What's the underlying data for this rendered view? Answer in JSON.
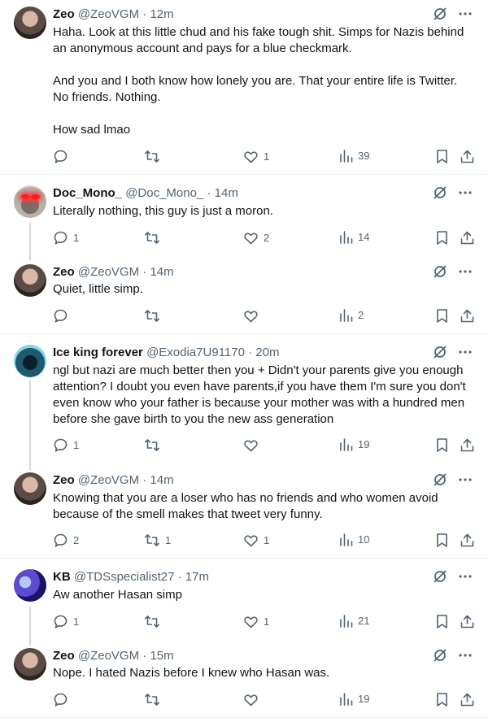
{
  "tweets": [
    {
      "name": "Zeo",
      "handle": "@ZeoVGM",
      "dot": "·",
      "time": "12m",
      "text": "Haha. Look at this little chud and his fake tough shit. Simps for Nazis behind an anonymous account and pays for a blue checkmark.\n\nAnd you and I both know how lonely you are. That your entire life is Twitter. No friends. Nothing.\n\nHow sad lmao",
      "replies": "",
      "retweets": "",
      "likes": "1",
      "views": "39"
    },
    {
      "name": "Doc_Mono_",
      "handle": "@Doc_Mono_",
      "dot": "·",
      "time": "14m",
      "text": "Literally nothing, this guy is just a moron.",
      "replies": "1",
      "retweets": "",
      "likes": "2",
      "views": "14"
    },
    {
      "name": "Zeo",
      "handle": "@ZeoVGM",
      "dot": "·",
      "time": "14m",
      "text": "Quiet, little simp.",
      "replies": "",
      "retweets": "",
      "likes": "",
      "views": "2"
    },
    {
      "name": "Ice king forever",
      "handle": "@Exodia7U91170",
      "dot": "·",
      "time": "20m",
      "text": "ngl but nazi are much better then you + Didn't your parents give you enough attention? I doubt you even have parents,if you have them I'm sure you don't even know who your father is because your mother was with a hundred men before she gave birth to you the new ass generation",
      "replies": "1",
      "retweets": "",
      "likes": "",
      "views": "19"
    },
    {
      "name": "Zeo",
      "handle": "@ZeoVGM",
      "dot": "·",
      "time": "14m",
      "text": "Knowing that you are a loser who has no friends and who women avoid because of the smell makes that tweet very funny.",
      "replies": "2",
      "retweets": "1",
      "likes": "1",
      "views": "10"
    },
    {
      "name": "KB",
      "handle": "@TDSspecialist27",
      "dot": "·",
      "time": "17m",
      "text": "Aw another Hasan simp",
      "replies": "1",
      "retweets": "",
      "likes": "1",
      "views": "21"
    },
    {
      "name": "Zeo",
      "handle": "@ZeoVGM",
      "dot": "·",
      "time": "15m",
      "text": "Nope. I hated Nazis before I knew who Hasan was.",
      "replies": "",
      "retweets": "",
      "likes": "",
      "views": "19"
    }
  ],
  "icons": {
    "grok": "grok-icon",
    "more": "more-icon",
    "reply": "reply-icon",
    "retweet": "retweet-icon",
    "like": "like-icon",
    "views": "views-icon",
    "bookmark": "bookmark-icon",
    "share": "share-icon"
  },
  "colors": {
    "text": "#0f1419",
    "muted": "#536471",
    "divider": "#eff3f4",
    "thread": "#cfd9de"
  }
}
